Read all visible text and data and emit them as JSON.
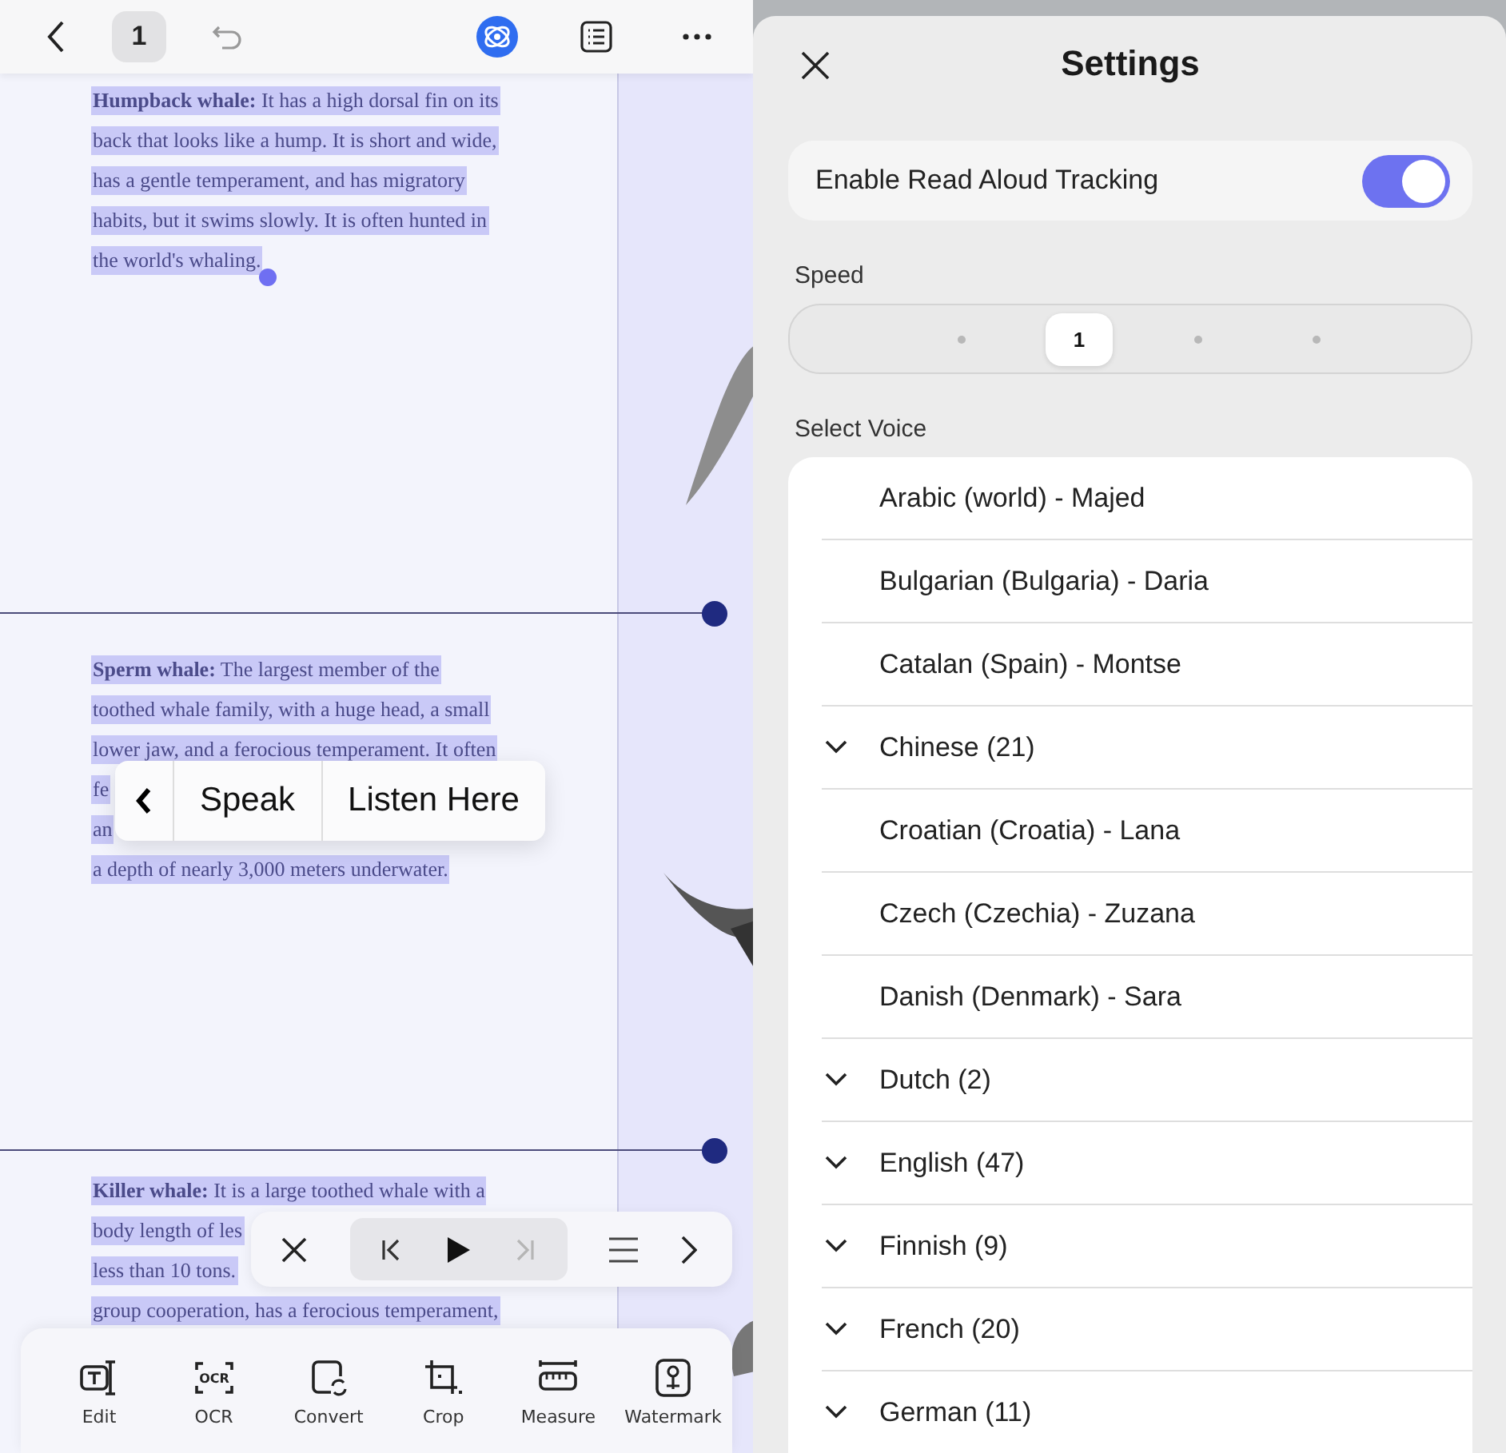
{
  "reader": {
    "page_number": "1",
    "paragraphs": [
      {
        "lines": [
          "**Humpback whale:** It has a high dorsal fin on its",
          "back that looks like a hump. It is short and wide,",
          "has a gentle temperament, and has migratory",
          "habits, but it swims slowly. It is often hunted in",
          "the world's whaling."
        ]
      },
      {
        "lines": [
          "**Sperm whale:** The largest member of the",
          "toothed whale family, with a huge head, a small",
          "lower jaw, and a ferocious temperament. It often",
          "fe",
          "an",
          "a depth of nearly 3,000 meters underwater."
        ]
      },
      {
        "lines": [
          "**Killer whale:** It is a large toothed whale with a",
          "body length of les",
          "less than 10 tons.",
          "group cooperation, has a ferocious temperament,"
        ]
      }
    ],
    "popup": {
      "items": [
        "Speak",
        "Listen Here"
      ]
    },
    "player": {
      "playing": false,
      "next_disabled": true
    },
    "tools": [
      {
        "label": "Edit",
        "kind": "edit"
      },
      {
        "label": "OCR",
        "kind": "ocr",
        "icon_text": "OCR"
      },
      {
        "label": "Convert",
        "kind": "convert"
      },
      {
        "label": "Crop",
        "kind": "crop"
      },
      {
        "label": "Measure",
        "kind": "measure"
      },
      {
        "label": "Watermark",
        "kind": "watermark"
      }
    ]
  },
  "settings": {
    "title": "Settings",
    "tracking": {
      "label": "Enable Read Aloud Tracking",
      "on": true
    },
    "speed": {
      "label": "Speed",
      "steps": [
        {
          "selected": false
        },
        {
          "selected": true,
          "label": "1"
        },
        {
          "selected": false
        },
        {
          "selected": false
        }
      ]
    },
    "voice_label": "Select Voice",
    "voices": [
      {
        "name": "Arabic (world) - Majed",
        "kind": "voice"
      },
      {
        "name": "Bulgarian (Bulgaria) - Daria",
        "kind": "voice"
      },
      {
        "name": "Catalan (Spain) - Montse",
        "kind": "voice"
      },
      {
        "name": "Chinese (21)",
        "kind": "group",
        "expanded": false
      },
      {
        "name": "Croatian (Croatia) - Lana",
        "kind": "voice"
      },
      {
        "name": "Czech (Czechia) - Zuzana",
        "kind": "voice"
      },
      {
        "name": "Danish (Denmark) - Sara",
        "kind": "voice"
      },
      {
        "name": "Dutch (2)",
        "kind": "group",
        "expanded": false
      },
      {
        "name": "English (47)",
        "kind": "group",
        "expanded": false
      },
      {
        "name": "Finnish (9)",
        "kind": "group",
        "expanded": false
      },
      {
        "name": "French (20)",
        "kind": "group",
        "expanded": false
      },
      {
        "name": "German (11)",
        "kind": "group",
        "expanded": false
      }
    ]
  }
}
